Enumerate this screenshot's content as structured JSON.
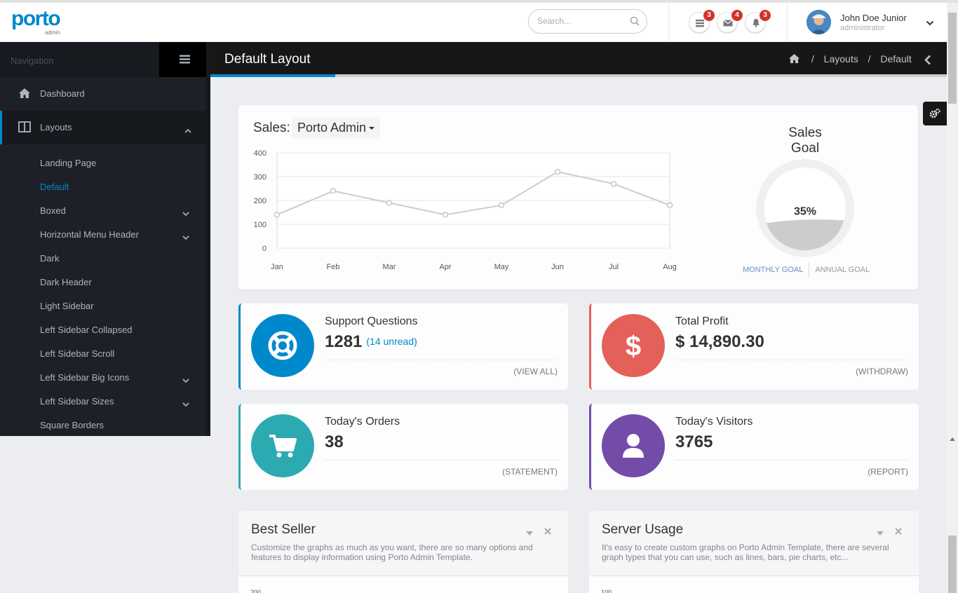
{
  "header": {
    "logo_text": "porto",
    "logo_sub": "admin",
    "search_placeholder": "Search...",
    "notifications": [
      {
        "icon": "tasks-icon",
        "count": "3"
      },
      {
        "icon": "envelope-icon",
        "count": "4"
      },
      {
        "icon": "bell-icon",
        "count": "3"
      }
    ],
    "user": {
      "name": "John Doe Junior",
      "role": "administrator"
    }
  },
  "sidebar": {
    "heading": "Navigation",
    "items": [
      {
        "label": "Dashboard",
        "icon": "home-icon"
      },
      {
        "label": "Layouts",
        "icon": "columns-icon",
        "expanded": true
      }
    ],
    "layouts_sub": [
      {
        "label": "Landing Page",
        "has_children": false,
        "selected": false
      },
      {
        "label": "Default",
        "has_children": false,
        "selected": true
      },
      {
        "label": "Boxed",
        "has_children": true,
        "selected": false
      },
      {
        "label": "Horizontal Menu Header",
        "has_children": true,
        "selected": false
      },
      {
        "label": "Dark",
        "has_children": false,
        "selected": false
      },
      {
        "label": "Dark Header",
        "has_children": false,
        "selected": false
      },
      {
        "label": "Light Sidebar",
        "has_children": false,
        "selected": false
      },
      {
        "label": "Left Sidebar Collapsed",
        "has_children": false,
        "selected": false
      },
      {
        "label": "Left Sidebar Scroll",
        "has_children": false,
        "selected": false
      },
      {
        "label": "Left Sidebar Big Icons",
        "has_children": true,
        "selected": false
      },
      {
        "label": "Left Sidebar Sizes",
        "has_children": true,
        "selected": false
      },
      {
        "label": "Square Borders",
        "has_children": false,
        "selected": false
      }
    ]
  },
  "page": {
    "title": "Default Layout",
    "breadcrumb": [
      "Layouts",
      "Default"
    ]
  },
  "sales": {
    "label": "Sales:",
    "selected": "Porto Admin",
    "goal_title": "Sales Goal",
    "goal_percent": "35%",
    "goal_value": 0.35,
    "tabs": [
      "MONTHLY GOAL",
      "ANNUAL GOAL"
    ]
  },
  "chart_data": {
    "type": "line",
    "categories": [
      "Jan",
      "Feb",
      "Mar",
      "Apr",
      "May",
      "Jun",
      "Jul",
      "Aug"
    ],
    "values": [
      140,
      240,
      190,
      140,
      180,
      320,
      270,
      180
    ],
    "yticks": [
      0,
      100,
      200,
      300,
      400
    ],
    "ylim": [
      0,
      400
    ],
    "grid": true
  },
  "widgets": [
    {
      "title": "Support Questions",
      "value": "1281",
      "extra": "(14 unread)",
      "link": "(VIEW ALL)",
      "color": "#0088cc",
      "icon": "life-ring-icon"
    },
    {
      "title": "Total Profit",
      "value": "$ 14,890.30",
      "extra": "",
      "link": "(WITHDRAW)",
      "color": "#e36159",
      "icon": "dollar-icon"
    },
    {
      "title": "Today's Orders",
      "value": "38",
      "extra": "",
      "link": "(STATEMENT)",
      "color": "#2baab1",
      "icon": "cart-icon"
    },
    {
      "title": "Today's Visitors",
      "value": "3765",
      "extra": "",
      "link": "(REPORT)",
      "color": "#734ba9",
      "icon": "user-icon"
    }
  ],
  "panels": [
    {
      "title": "Best Seller",
      "desc": "Customize the graphs as much as you want, there are so many options and features to display information using Porto Admin Template.",
      "axis_label": "200"
    },
    {
      "title": "Server Usage",
      "desc": "It's easy to create custom graphs on Porto Admin Template, there are several graph types that you can use, such as lines, bars, pie charts, etc...",
      "axis_label": "100"
    }
  ]
}
